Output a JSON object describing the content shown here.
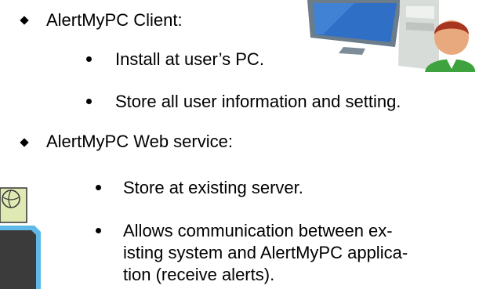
{
  "items": [
    {
      "label": "AlertMyPC Client:",
      "sub": [
        "Install at user’s PC.",
        "Store all user information and setting."
      ]
    },
    {
      "label": "AlertMyPC Web service:",
      "sub": [
        "Store at existing server.",
        "Allows communication between ex-",
        "isting system and AlertMyPC applica-",
        "tion (receive alerts)."
      ]
    }
  ],
  "icons": {
    "pc_user": "computer-with-user-icon",
    "server": "globe-server-icon"
  },
  "colors": {
    "text": "#000000",
    "monitor_frame": "#5a6b7a",
    "screen": "#2f6fc6",
    "globe_panel": "#dfe9b3",
    "server_body": "#3b3b3b",
    "server_edge": "#5fb9e6"
  }
}
